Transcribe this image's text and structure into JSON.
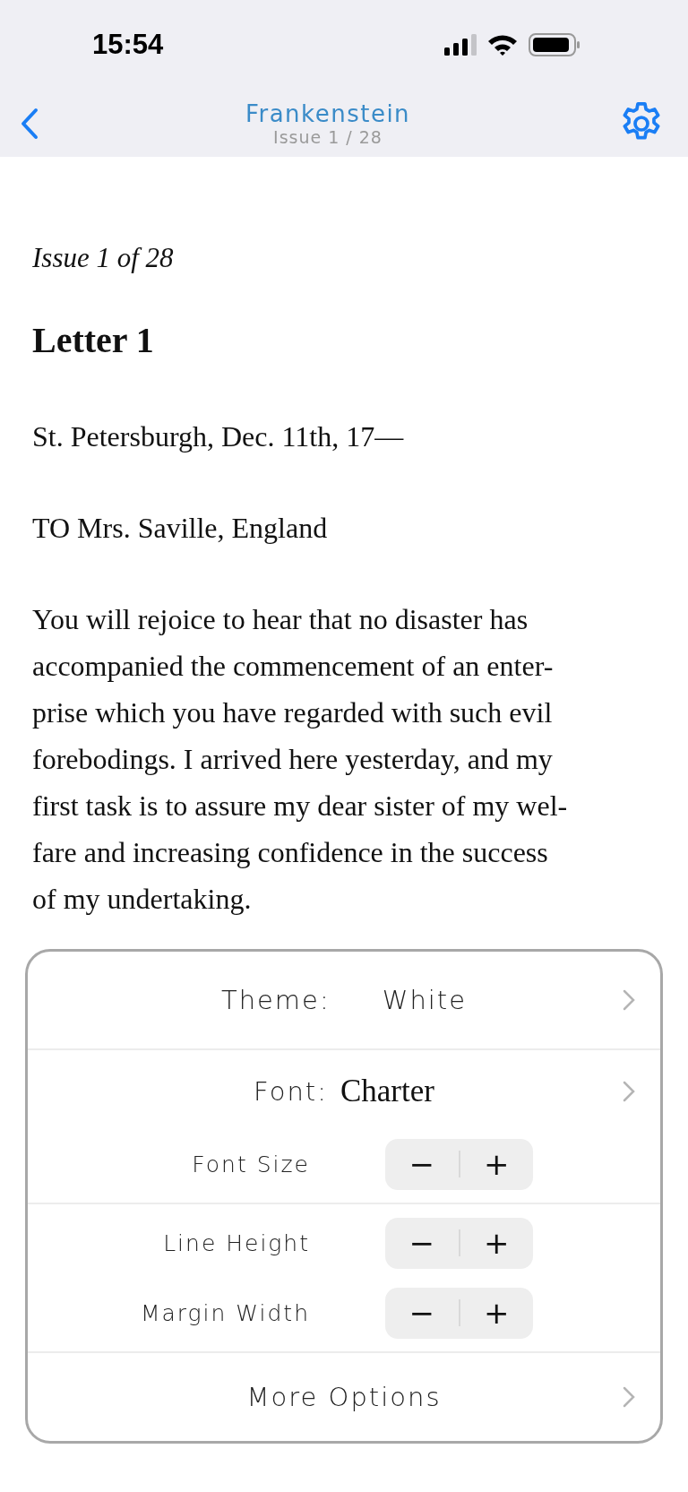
{
  "status_bar": {
    "time": "15:54"
  },
  "nav_bar": {
    "title": "Frankenstein",
    "subtitle": "Issue 1 / 28"
  },
  "article": {
    "issue": "Issue 1 of 28",
    "chapter": "Letter 1",
    "place_date": "St. Petersburgh, Dec. 11th, 17—",
    "address": "TO Mrs. Saville, England",
    "paragraph_lines": [
      "You will rejoice to hear that no disaster has",
      "accompanied the commencement of an enter-",
      "prise which you have regarded with such evil",
      "forebodings. I arrived here yesterday, and my",
      "first task is to assure my dear sister of my wel-",
      "fare and increasing confidence in the success",
      "of my undertaking."
    ]
  },
  "settings": {
    "groups": [
      [
        {
          "kind": "choice",
          "label": "Theme:",
          "value": "White"
        }
      ],
      [
        {
          "kind": "font-choice",
          "label": "Font:",
          "value": "Charter"
        },
        {
          "kind": "stepper",
          "label": "Font Size",
          "minus": "−",
          "plus": "+"
        }
      ],
      [
        {
          "kind": "stepper",
          "label": "Line Height",
          "minus": "−",
          "plus": "+"
        },
        {
          "kind": "stepper",
          "label": "Margin Width",
          "minus": "−",
          "plus": "+"
        }
      ],
      [
        {
          "kind": "link",
          "label": "More Options"
        }
      ]
    ]
  }
}
